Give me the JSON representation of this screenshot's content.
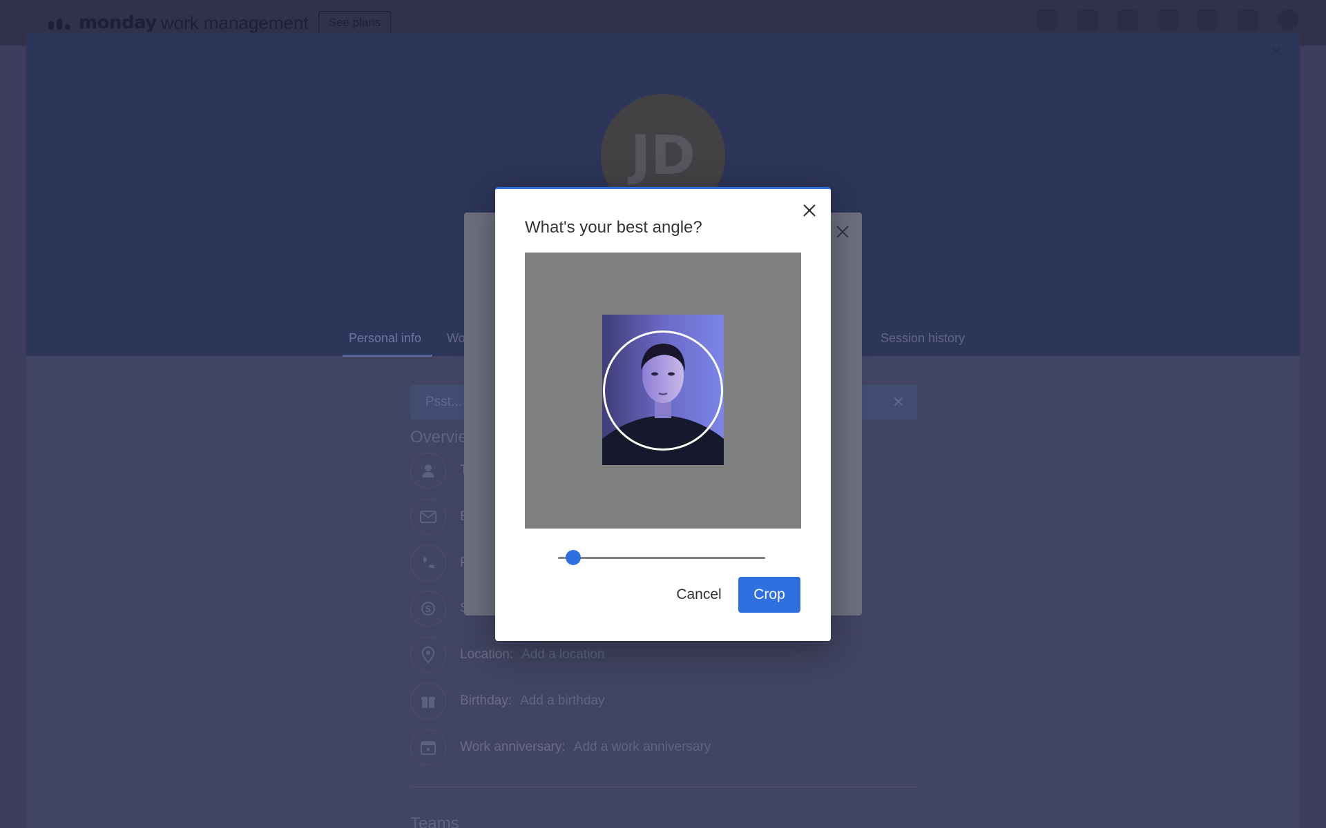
{
  "topbar": {
    "brand": "monday",
    "brand_suffix": "work management",
    "see_plans_label": "See plans",
    "icons": [
      "notifications-icon",
      "inbox-icon",
      "invite-members-icon",
      "apps-icon",
      "search-icon",
      "help-icon",
      "user-avatar"
    ]
  },
  "profile": {
    "initials": "JD",
    "tabs": [
      "Personal info",
      "Wo",
      "Session history"
    ],
    "active_tab": "Personal info",
    "notice_text": "Psst... a",
    "overview_title": "Overvie",
    "fields": [
      {
        "icon": "person-icon",
        "label": "T",
        "value": ""
      },
      {
        "icon": "email-icon",
        "label": "E",
        "value": ""
      },
      {
        "icon": "phone-icon",
        "label": "P",
        "value": ""
      },
      {
        "icon": "skype-icon",
        "label": "S",
        "value": ""
      },
      {
        "icon": "location-icon",
        "label": "Location:",
        "value": "Add a location"
      },
      {
        "icon": "gift-icon",
        "label": "Birthday:",
        "value": "Add a birthday"
      },
      {
        "icon": "calendar-icon",
        "label": "Work anniversary:",
        "value": "Add a work anniversary"
      }
    ],
    "teams_title": "Teams"
  },
  "crop_dialog": {
    "title": "What's your best angle?",
    "zoom_fraction": 0.04,
    "cancel_label": "Cancel",
    "crop_label": "Crop"
  },
  "colors": {
    "accent": "#2f6fe0",
    "overlay": "#3c3d5c",
    "crop_backdrop": "#808080"
  }
}
